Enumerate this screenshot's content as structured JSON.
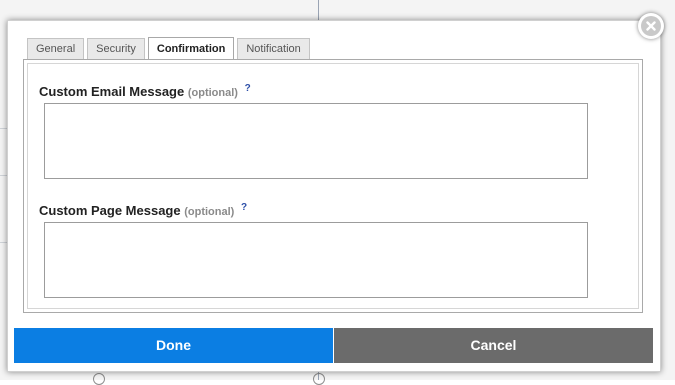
{
  "dialog": {
    "tabs": [
      {
        "label": "General",
        "active": false
      },
      {
        "label": "Security",
        "active": false
      },
      {
        "label": "Confirmation",
        "active": true
      },
      {
        "label": "Notification",
        "active": false
      }
    ],
    "fields": {
      "email": {
        "label": "Custom Email Message",
        "optional": "(optional)",
        "help": "?",
        "value": ""
      },
      "page": {
        "label": "Custom Page Message",
        "optional": "(optional)",
        "help": "?",
        "value": ""
      }
    },
    "buttons": {
      "done": "Done",
      "cancel": "Cancel"
    },
    "close_icon": "close-icon"
  },
  "colors": {
    "done_button": "#0b7ee3",
    "cancel_button": "#6b6b6b",
    "help_link": "#2d4fa8"
  }
}
